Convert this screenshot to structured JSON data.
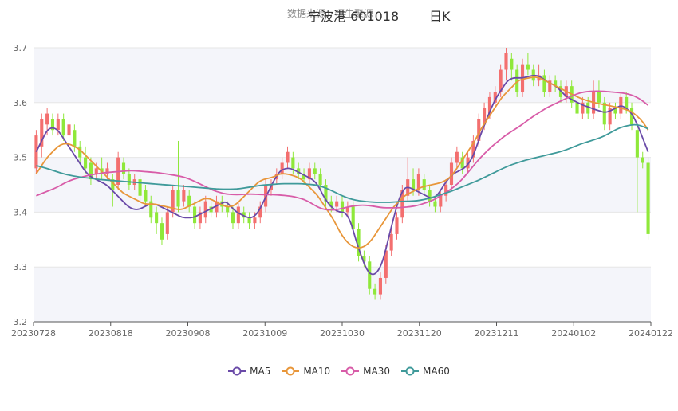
{
  "chart_data": {
    "type": "candlestick",
    "title": "宁波港 601018",
    "subtitle": "数据来源：恒生聚源",
    "period": "日K",
    "ylim": [
      3.2,
      3.7
    ],
    "yticks": [
      3.2,
      3.3,
      3.4,
      3.5,
      3.6,
      3.7
    ],
    "xtick_labels": [
      "20230728",
      "20230818",
      "20230908",
      "20231009",
      "20231030",
      "20231120",
      "20231211",
      "20240102",
      "20240122"
    ],
    "colors": {
      "up": "#f36f6f",
      "down": "#8fe83a",
      "MA5": "#6a4aa8",
      "MA10": "#e8963a",
      "MA30": "#d85ca8",
      "MA60": "#3f9a9a",
      "grid_band": "#f4f5fa"
    },
    "candles": [
      [
        3.48,
        3.54,
        3.47,
        3.55
      ],
      [
        3.52,
        3.57,
        3.5,
        3.58
      ],
      [
        3.56,
        3.58,
        3.54,
        3.59
      ],
      [
        3.57,
        3.55,
        3.54,
        3.58
      ],
      [
        3.55,
        3.57,
        3.54,
        3.58
      ],
      [
        3.57,
        3.54,
        3.53,
        3.58
      ],
      [
        3.54,
        3.56,
        3.53,
        3.57
      ],
      [
        3.55,
        3.52,
        3.51,
        3.56
      ],
      [
        3.52,
        3.5,
        3.49,
        3.53
      ],
      [
        3.5,
        3.48,
        3.47,
        3.52
      ],
      [
        3.49,
        3.46,
        3.45,
        3.5
      ],
      [
        3.47,
        3.48,
        3.46,
        3.49
      ],
      [
        3.48,
        3.47,
        3.46,
        3.5
      ],
      [
        3.47,
        3.48,
        3.46,
        3.49
      ],
      [
        3.46,
        3.44,
        3.41,
        3.47
      ],
      [
        3.45,
        3.5,
        3.44,
        3.51
      ],
      [
        3.49,
        3.47,
        3.46,
        3.5
      ],
      [
        3.47,
        3.45,
        3.44,
        3.48
      ],
      [
        3.45,
        3.46,
        3.44,
        3.47
      ],
      [
        3.46,
        3.43,
        3.42,
        3.47
      ],
      [
        3.44,
        3.42,
        3.41,
        3.45
      ],
      [
        3.42,
        3.39,
        3.38,
        3.43
      ],
      [
        3.4,
        3.38,
        3.36,
        3.41
      ],
      [
        3.38,
        3.35,
        3.34,
        3.39
      ],
      [
        3.36,
        3.4,
        3.35,
        3.41
      ],
      [
        3.4,
        3.44,
        3.39,
        3.45
      ],
      [
        3.44,
        3.41,
        3.4,
        3.53
      ],
      [
        3.42,
        3.44,
        3.41,
        3.45
      ],
      [
        3.43,
        3.41,
        3.4,
        3.44
      ],
      [
        3.41,
        3.38,
        3.37,
        3.42
      ],
      [
        3.38,
        3.4,
        3.37,
        3.41
      ],
      [
        3.39,
        3.42,
        3.38,
        3.43
      ],
      [
        3.41,
        3.4,
        3.39,
        3.42
      ],
      [
        3.4,
        3.42,
        3.39,
        3.43
      ],
      [
        3.42,
        3.41,
        3.4,
        3.43
      ],
      [
        3.41,
        3.4,
        3.39,
        3.42
      ],
      [
        3.4,
        3.38,
        3.37,
        3.41
      ],
      [
        3.38,
        3.41,
        3.37,
        3.42
      ],
      [
        3.4,
        3.39,
        3.38,
        3.41
      ],
      [
        3.39,
        3.38,
        3.37,
        3.4
      ],
      [
        3.38,
        3.39,
        3.37,
        3.4
      ],
      [
        3.39,
        3.41,
        3.38,
        3.42
      ],
      [
        3.41,
        3.45,
        3.4,
        3.46
      ],
      [
        3.44,
        3.45,
        3.43,
        3.46
      ],
      [
        3.46,
        3.47,
        3.45,
        3.48
      ],
      [
        3.47,
        3.49,
        3.46,
        3.5
      ],
      [
        3.49,
        3.51,
        3.48,
        3.52
      ],
      [
        3.5,
        3.48,
        3.47,
        3.51
      ],
      [
        3.48,
        3.47,
        3.46,
        3.49
      ],
      [
        3.47,
        3.46,
        3.45,
        3.48
      ],
      [
        3.46,
        3.48,
        3.45,
        3.49
      ],
      [
        3.48,
        3.47,
        3.46,
        3.49
      ],
      [
        3.47,
        3.45,
        3.44,
        3.48
      ],
      [
        3.45,
        3.42,
        3.41,
        3.46
      ],
      [
        3.42,
        3.41,
        3.4,
        3.43
      ],
      [
        3.41,
        3.42,
        3.4,
        3.43
      ],
      [
        3.42,
        3.4,
        3.39,
        3.43
      ],
      [
        3.4,
        3.41,
        3.39,
        3.42
      ],
      [
        3.41,
        3.37,
        3.36,
        3.42
      ],
      [
        3.37,
        3.32,
        3.31,
        3.38
      ],
      [
        3.32,
        3.31,
        3.3,
        3.33
      ],
      [
        3.31,
        3.26,
        3.25,
        3.32
      ],
      [
        3.26,
        3.25,
        3.24,
        3.27
      ],
      [
        3.25,
        3.28,
        3.24,
        3.29
      ],
      [
        3.28,
        3.33,
        3.27,
        3.34
      ],
      [
        3.33,
        3.36,
        3.32,
        3.37
      ],
      [
        3.36,
        3.39,
        3.35,
        3.4
      ],
      [
        3.39,
        3.44,
        3.38,
        3.45
      ],
      [
        3.43,
        3.46,
        3.42,
        3.5
      ],
      [
        3.46,
        3.44,
        3.43,
        3.48
      ],
      [
        3.44,
        3.47,
        3.43,
        3.48
      ],
      [
        3.46,
        3.44,
        3.43,
        3.47
      ],
      [
        3.44,
        3.42,
        3.41,
        3.45
      ],
      [
        3.42,
        3.41,
        3.4,
        3.43
      ],
      [
        3.41,
        3.43,
        3.4,
        3.44
      ],
      [
        3.43,
        3.45,
        3.42,
        3.46
      ],
      [
        3.45,
        3.49,
        3.44,
        3.5
      ],
      [
        3.49,
        3.51,
        3.48,
        3.52
      ],
      [
        3.5,
        3.48,
        3.47,
        3.51
      ],
      [
        3.48,
        3.5,
        3.47,
        3.51
      ],
      [
        3.5,
        3.53,
        3.49,
        3.54
      ],
      [
        3.53,
        3.57,
        3.52,
        3.58
      ],
      [
        3.56,
        3.59,
        3.55,
        3.6
      ],
      [
        3.58,
        3.61,
        3.57,
        3.62
      ],
      [
        3.6,
        3.62,
        3.59,
        3.63
      ],
      [
        3.62,
        3.66,
        3.61,
        3.67
      ],
      [
        3.66,
        3.69,
        3.64,
        3.7
      ],
      [
        3.68,
        3.66,
        3.64,
        3.69
      ],
      [
        3.66,
        3.62,
        3.61,
        3.67
      ],
      [
        3.62,
        3.67,
        3.61,
        3.68
      ],
      [
        3.67,
        3.66,
        3.65,
        3.69
      ],
      [
        3.66,
        3.64,
        3.63,
        3.67
      ],
      [
        3.64,
        3.65,
        3.63,
        3.67
      ],
      [
        3.65,
        3.62,
        3.61,
        3.66
      ],
      [
        3.62,
        3.64,
        3.61,
        3.65
      ],
      [
        3.64,
        3.63,
        3.62,
        3.65
      ],
      [
        3.63,
        3.61,
        3.6,
        3.64
      ],
      [
        3.61,
        3.63,
        3.6,
        3.64
      ],
      [
        3.63,
        3.6,
        3.59,
        3.64
      ],
      [
        3.6,
        3.58,
        3.57,
        3.61
      ],
      [
        3.58,
        3.6,
        3.57,
        3.61
      ],
      [
        3.6,
        3.58,
        3.57,
        3.61
      ],
      [
        3.58,
        3.62,
        3.57,
        3.64
      ],
      [
        3.62,
        3.6,
        3.59,
        3.64
      ],
      [
        3.6,
        3.56,
        3.55,
        3.61
      ],
      [
        3.56,
        3.59,
        3.55,
        3.6
      ],
      [
        3.59,
        3.58,
        3.57,
        3.6
      ],
      [
        3.58,
        3.61,
        3.57,
        3.62
      ],
      [
        3.61,
        3.59,
        3.58,
        3.62
      ],
      [
        3.59,
        3.56,
        3.55,
        3.6
      ],
      [
        3.55,
        3.5,
        3.4,
        3.56
      ],
      [
        3.5,
        3.49,
        3.48,
        3.51
      ],
      [
        3.49,
        3.36,
        3.35,
        3.5
      ]
    ],
    "series": [
      {
        "name": "MA5",
        "values": [
          3.51,
          3.53,
          3.55,
          3.555,
          3.55,
          3.535,
          3.52,
          3.505,
          3.49,
          3.475,
          3.465,
          3.46,
          3.455,
          3.45,
          3.44,
          3.43,
          3.42,
          3.41,
          3.405,
          3.405,
          3.41,
          3.415,
          3.415,
          3.41,
          3.405,
          3.4,
          3.395,
          3.39,
          3.39,
          3.39,
          3.395,
          3.4,
          3.405,
          3.41,
          3.415,
          3.42,
          3.41,
          3.4,
          3.395,
          3.39,
          3.39,
          3.4,
          3.42,
          3.44,
          3.46,
          3.475,
          3.48,
          3.48,
          3.475,
          3.47,
          3.465,
          3.46,
          3.45,
          3.43,
          3.415,
          3.405,
          3.4,
          3.4,
          3.385,
          3.35,
          3.32,
          3.295,
          3.285,
          3.29,
          3.31,
          3.35,
          3.39,
          3.425,
          3.445,
          3.445,
          3.44,
          3.435,
          3.43,
          3.425,
          3.43,
          3.445,
          3.46,
          3.47,
          3.475,
          3.48,
          3.49,
          3.51,
          3.54,
          3.565,
          3.59,
          3.61,
          3.625,
          3.64,
          3.645,
          3.645,
          3.645,
          3.648,
          3.65,
          3.648,
          3.64,
          3.635,
          3.63,
          3.62,
          3.61,
          3.605,
          3.6,
          3.595,
          3.592,
          3.588,
          3.585,
          3.582,
          3.585,
          3.59,
          3.595,
          3.59,
          3.58,
          3.56,
          3.535,
          3.51
        ]
      },
      {
        "name": "MA10",
        "values": [
          3.47,
          3.485,
          3.5,
          3.51,
          3.52,
          3.525,
          3.525,
          3.52,
          3.515,
          3.505,
          3.495,
          3.485,
          3.475,
          3.465,
          3.455,
          3.445,
          3.435,
          3.43,
          3.425,
          3.42,
          3.415,
          3.415,
          3.415,
          3.412,
          3.41,
          3.408,
          3.405,
          3.405,
          3.41,
          3.415,
          3.42,
          3.425,
          3.425,
          3.42,
          3.415,
          3.41,
          3.41,
          3.415,
          3.425,
          3.435,
          3.445,
          3.455,
          3.46,
          3.462,
          3.465,
          3.47,
          3.47,
          3.468,
          3.465,
          3.46,
          3.45,
          3.44,
          3.43,
          3.415,
          3.4,
          3.385,
          3.365,
          3.35,
          3.34,
          3.335,
          3.335,
          3.34,
          3.35,
          3.365,
          3.38,
          3.395,
          3.41,
          3.42,
          3.43,
          3.435,
          3.44,
          3.445,
          3.448,
          3.45,
          3.452,
          3.455,
          3.46,
          3.47,
          3.485,
          3.5,
          3.515,
          3.53,
          3.55,
          3.565,
          3.58,
          3.595,
          3.61,
          3.62,
          3.63,
          3.64,
          3.643,
          3.645,
          3.647,
          3.645,
          3.64,
          3.635,
          3.63,
          3.625,
          3.62,
          3.615,
          3.61,
          3.606,
          3.603,
          3.6,
          3.598,
          3.596,
          3.594,
          3.592,
          3.59,
          3.587,
          3.583,
          3.575,
          3.565,
          3.55
        ]
      },
      {
        "name": "MA30",
        "values": [
          3.43,
          3.435,
          3.44,
          3.445,
          3.452,
          3.458,
          3.462,
          3.465,
          3.468,
          3.47,
          3.472,
          3.473,
          3.474,
          3.475,
          3.476,
          3.475,
          3.474,
          3.473,
          3.472,
          3.47,
          3.468,
          3.466,
          3.463,
          3.458,
          3.452,
          3.446,
          3.44,
          3.436,
          3.433,
          3.432,
          3.432,
          3.433,
          3.433,
          3.432,
          3.432,
          3.432,
          3.431,
          3.43,
          3.428,
          3.425,
          3.42,
          3.412,
          3.406,
          3.404,
          3.404,
          3.407,
          3.41,
          3.412,
          3.413,
          3.412,
          3.41,
          3.408,
          3.408,
          3.408,
          3.409,
          3.41,
          3.412,
          3.416,
          3.42,
          3.426,
          3.434,
          3.442,
          3.452,
          3.465,
          3.48,
          3.495,
          3.508,
          3.52,
          3.53,
          3.54,
          3.548,
          3.556,
          3.565,
          3.574,
          3.582,
          3.59,
          3.596,
          3.602,
          3.608,
          3.613,
          3.618,
          3.62,
          3.621,
          3.621,
          3.62,
          3.619,
          3.618,
          3.616,
          3.612,
          3.605,
          3.595
        ]
      },
      {
        "name": "MA60",
        "values": [
          3.485,
          3.482,
          3.478,
          3.474,
          3.47,
          3.467,
          3.465,
          3.463,
          3.462,
          3.46,
          3.459,
          3.458,
          3.457,
          3.456,
          3.455,
          3.454,
          3.453,
          3.452,
          3.451,
          3.45,
          3.449,
          3.448,
          3.447,
          3.446,
          3.445,
          3.444,
          3.443,
          3.442,
          3.442,
          3.442,
          3.443,
          3.445,
          3.447,
          3.449,
          3.45,
          3.451,
          3.452,
          3.452,
          3.452,
          3.452,
          3.451,
          3.45,
          3.447,
          3.442,
          3.436,
          3.43,
          3.425,
          3.422,
          3.42,
          3.419,
          3.418,
          3.418,
          3.418,
          3.419,
          3.42,
          3.42,
          3.421,
          3.423,
          3.426,
          3.43,
          3.434,
          3.438,
          3.443,
          3.448,
          3.453,
          3.458,
          3.464,
          3.47,
          3.476,
          3.482,
          3.487,
          3.491,
          3.495,
          3.498,
          3.501,
          3.504,
          3.507,
          3.51,
          3.514,
          3.519,
          3.524,
          3.528,
          3.532,
          3.536,
          3.542,
          3.549,
          3.555,
          3.558,
          3.56,
          3.558,
          3.552
        ]
      }
    ],
    "legend": [
      "MA5",
      "MA10",
      "MA30",
      "MA60"
    ]
  }
}
